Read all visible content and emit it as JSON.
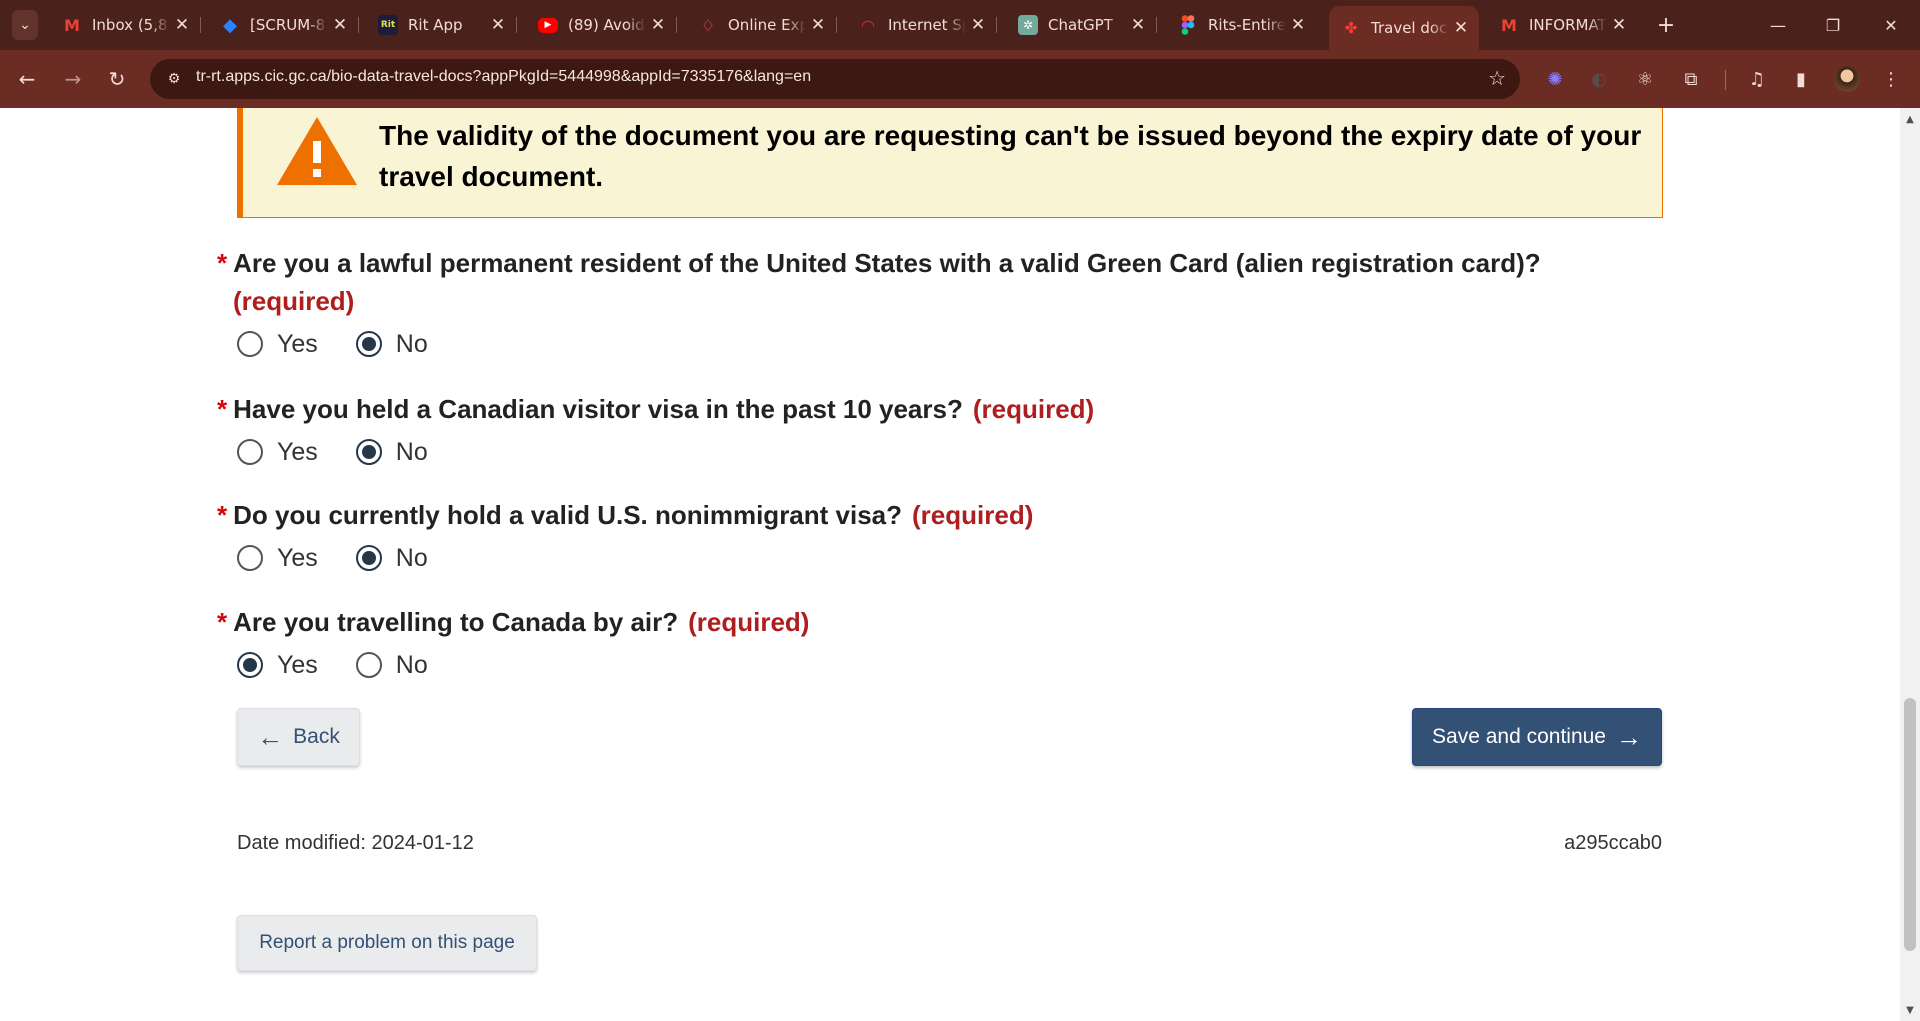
{
  "browser": {
    "tabs": [
      {
        "title": "Inbox (5,82",
        "icon": "gmail-icon"
      },
      {
        "title": "[SCRUM-8",
        "icon": "jira-icon"
      },
      {
        "title": "Rit App",
        "icon": "rit-icon",
        "icon_text": "Rit"
      },
      {
        "title": "(89) Avoid",
        "icon": "youtube-icon"
      },
      {
        "title": "Online Exp",
        "icon": "airbnb-icon"
      },
      {
        "title": "Internet Sp",
        "icon": "speedtest-icon"
      },
      {
        "title": "ChatGPT",
        "icon": "chatgpt-icon"
      },
      {
        "title": "Rits-Entire",
        "icon": "figma-icon"
      },
      {
        "title": "Travel doc",
        "icon": "maple-leaf-icon",
        "active": true
      },
      {
        "title": "INFORMAT",
        "icon": "gmail-icon"
      }
    ],
    "url": "tr-rt.apps.cic.gc.ca/bio-data-travel-docs?appPkgId=5444998&appId=7335176&lang=en",
    "theme_colors": {
      "tabbar": "#4a211b",
      "toolbar": "#6b2c23"
    }
  },
  "alert": {
    "text": "The validity of the document you are requesting can't be issued beyond the expiry date of your travel document.",
    "color": "#ee7100"
  },
  "form": {
    "required_marker": "*",
    "required_label": "(required)",
    "questions": [
      {
        "label": "Are you a lawful permanent resident of the United States with a valid Green Card (alien registration card)?",
        "options": [
          "Yes",
          "No"
        ],
        "selected": "No"
      },
      {
        "label": "Have you held a Canadian visitor visa in the past 10 years?",
        "options": [
          "Yes",
          "No"
        ],
        "selected": "No"
      },
      {
        "label": "Do you currently hold a valid U.S. nonimmigrant visa?",
        "options": [
          "Yes",
          "No"
        ],
        "selected": "No"
      },
      {
        "label": "Are you travelling to Canada by air?",
        "options": [
          "Yes",
          "No"
        ],
        "selected": "Yes"
      }
    ]
  },
  "actions": {
    "back_label": "Back",
    "save_label": "Save and continue"
  },
  "footer": {
    "date_modified": "Date modified: 2024-01-12",
    "version": "a295ccab0",
    "report_label": "Report a problem on this page"
  }
}
